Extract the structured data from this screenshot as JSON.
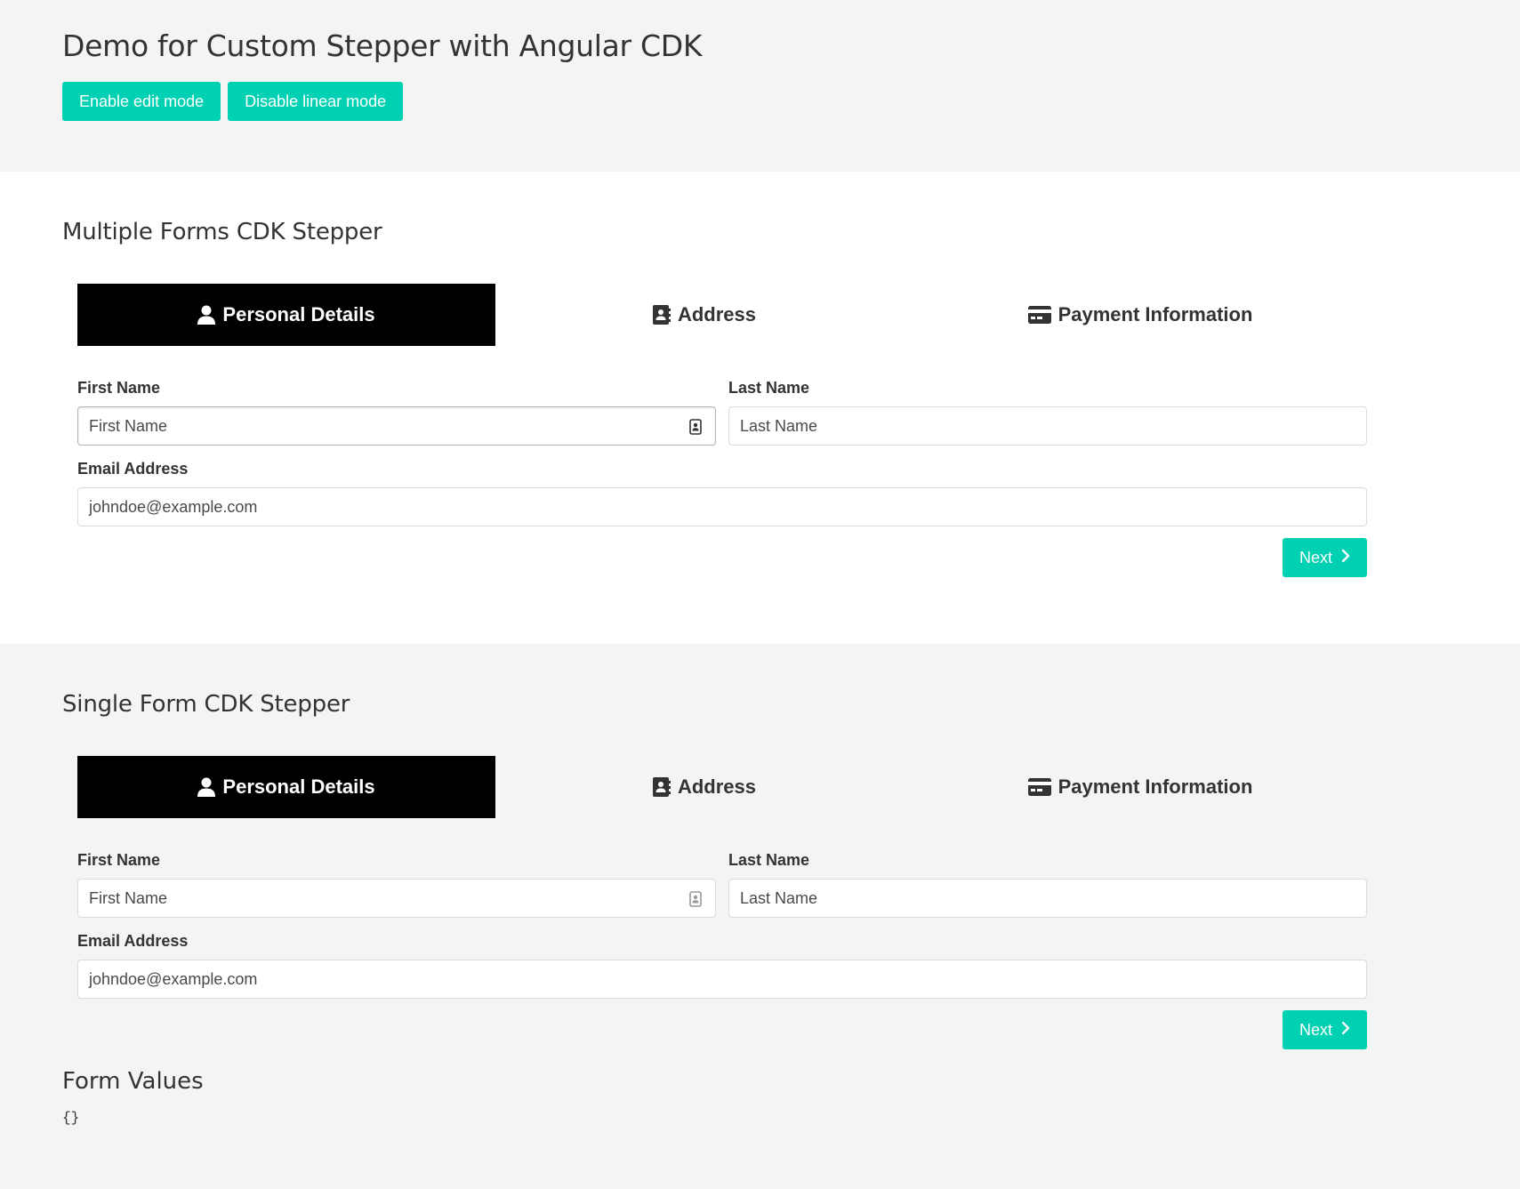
{
  "header": {
    "title": "Demo for Custom Stepper with Angular CDK",
    "enable_edit_label": "Enable edit mode",
    "disable_linear_label": "Disable linear mode"
  },
  "multiple": {
    "title": "Multiple Forms CDK Stepper",
    "steps": [
      {
        "label": "Personal Details",
        "icon": "user-icon"
      },
      {
        "label": "Address",
        "icon": "address-book-icon"
      },
      {
        "label": "Payment Information",
        "icon": "credit-card-icon"
      }
    ],
    "first_name_label": "First Name",
    "first_name_placeholder": "First Name",
    "last_name_label": "Last Name",
    "last_name_placeholder": "Last Name",
    "email_label": "Email Address",
    "email_placeholder": "johndoe@example.com",
    "next_label": "Next"
  },
  "single": {
    "title": "Single Form CDK Stepper",
    "steps": [
      {
        "label": "Personal Details",
        "icon": "user-icon"
      },
      {
        "label": "Address",
        "icon": "address-book-icon"
      },
      {
        "label": "Payment Information",
        "icon": "credit-card-icon"
      }
    ],
    "first_name_label": "First Name",
    "first_name_placeholder": "First Name",
    "last_name_label": "Last Name",
    "last_name_placeholder": "Last Name",
    "email_label": "Email Address",
    "email_placeholder": "johndoe@example.com",
    "next_label": "Next"
  },
  "form_values": {
    "title": "Form Values",
    "json": "{}"
  },
  "colors": {
    "accent": "#00d1b2",
    "active_step_bg": "#000000"
  }
}
